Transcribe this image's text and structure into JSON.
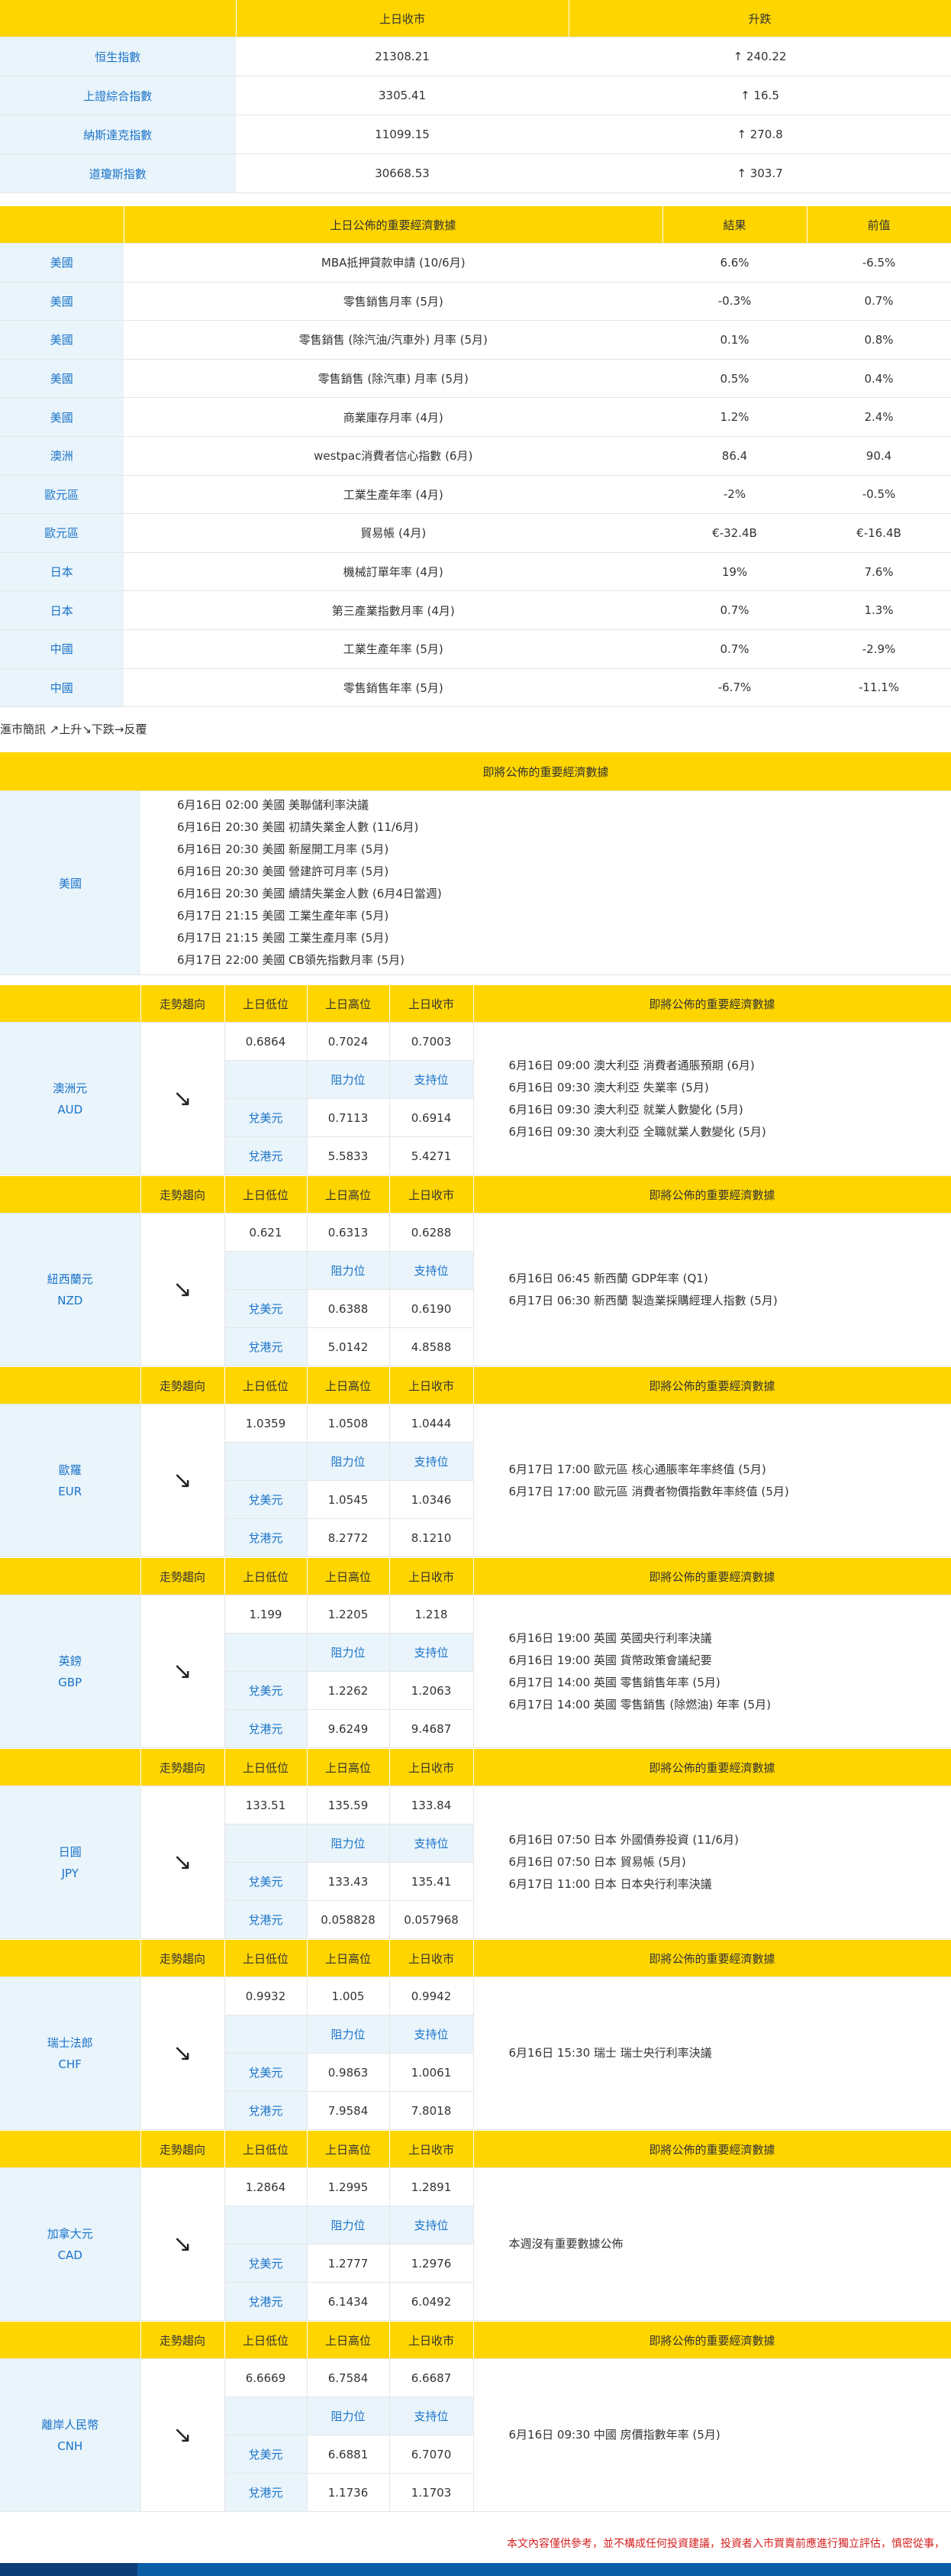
{
  "indices": {
    "headers": [
      "上日收市",
      "升跌"
    ],
    "rows": [
      {
        "name": "恒生指數",
        "close": "21308.21",
        "change": "↑  240.22"
      },
      {
        "name": "上證綜合指數",
        "close": "3305.41",
        "change": "↑  16.5"
      },
      {
        "name": "納斯達克指數",
        "close": "11099.15",
        "change": "↑  270.8"
      },
      {
        "name": "道瓊斯指數",
        "close": "30668.53",
        "change": "↑  303.7"
      }
    ]
  },
  "economic": {
    "headers": [
      "上日公佈的重要經濟數據",
      "結果",
      "前值"
    ],
    "rows": [
      {
        "region": "美國",
        "item": "MBA抵押貸款申請 (10/6月)",
        "result": "6.6%",
        "prev": "-6.5%"
      },
      {
        "region": "美國",
        "item": "零售銷售月率 (5月)",
        "result": "-0.3%",
        "prev": "0.7%"
      },
      {
        "region": "美國",
        "item": "零售銷售 (除汽油/汽車外) 月率 (5月)",
        "result": "0.1%",
        "prev": "0.8%"
      },
      {
        "region": "美國",
        "item": "零售銷售 (除汽車) 月率 (5月)",
        "result": "0.5%",
        "prev": "0.4%"
      },
      {
        "region": "美國",
        "item": "商業庫存月率 (4月)",
        "result": "1.2%",
        "prev": "2.4%"
      },
      {
        "region": "澳洲",
        "item": "westpac消費者信心指數 (6月)",
        "result": "86.4",
        "prev": "90.4"
      },
      {
        "region": "歐元區",
        "item": "工業生產年率 (4月)",
        "result": "-2%",
        "prev": "-0.5%"
      },
      {
        "region": "歐元區",
        "item": "貿易帳 (4月)",
        "result": "€-32.4B",
        "prev": "€-16.4B"
      },
      {
        "region": "日本",
        "item": "機械訂單年率 (4月)",
        "result": "19%",
        "prev": "7.6%"
      },
      {
        "region": "日本",
        "item": "第三產業指數月率 (4月)",
        "result": "0.7%",
        "prev": "1.3%"
      },
      {
        "region": "中國",
        "item": "工業生產年率 (5月)",
        "result": "0.7%",
        "prev": "-2.9%"
      },
      {
        "region": "中國",
        "item": "零售銷售年率 (5月)",
        "result": "-6.7%",
        "prev": "-11.1%"
      }
    ]
  },
  "legend": "滙市簡訊 ↗上升↘下跌→反覆",
  "upcoming_us": {
    "header": "即將公佈的重要經濟數據",
    "region": "美國",
    "events": [
      "6月16日 02:00 美國 美聯儲利率決議",
      "6月16日 20:30 美國 初請失業金人數 (11/6月)",
      "6月16日 20:30 美國 新屋開工月率 (5月)",
      "6月16日 20:30 美國 營建許可月率 (5月)",
      "6月16日 20:30 美國 續請失業金人數 (6月4日當週)",
      "6月17日 21:15 美國 工業生產年率 (5月)",
      "6月17日 21:15 美國 工業生產月率 (5月)",
      "6月17日 22:00 美國 CB領先指數月率 (5月)"
    ]
  },
  "fx_headers": {
    "trend": "走勢趨向",
    "low": "上日低位",
    "high": "上日高位",
    "close": "上日收市",
    "events": "即將公佈的重要經濟數據",
    "resistance": "阻力位",
    "support": "支持位",
    "vs_usd": "兌美元",
    "vs_hkd": "兌港元"
  },
  "currencies": [
    {
      "name": "澳洲元",
      "code": "AUD",
      "trend": "↘",
      "low": "0.6864",
      "high": "0.7024",
      "close": "0.7003",
      "usd_res": "0.7113",
      "usd_sup": "0.6914",
      "hkd_res": "5.5833",
      "hkd_sup": "5.4271",
      "events": [
        "6月16日 09:00 澳大利亞 消費者通脹預期 (6月)",
        "6月16日 09:30 澳大利亞 失業率 (5月)",
        "6月16日 09:30 澳大利亞 就業人數變化 (5月)",
        "6月16日 09:30 澳大利亞 全職就業人數變化 (5月)"
      ]
    },
    {
      "name": "紐西蘭元",
      "code": "NZD",
      "trend": "↘",
      "low": "0.621",
      "high": "0.6313",
      "close": "0.6288",
      "usd_res": "0.6388",
      "usd_sup": "0.6190",
      "hkd_res": "5.0142",
      "hkd_sup": "4.8588",
      "events": [
        "6月16日 06:45 新西蘭 GDP年率 (Q1)",
        "6月17日 06:30 新西蘭 製造業採購經理人指數 (5月)"
      ]
    },
    {
      "name": "歐羅",
      "code": "EUR",
      "trend": "↘",
      "low": "1.0359",
      "high": "1.0508",
      "close": "1.0444",
      "usd_res": "1.0545",
      "usd_sup": "1.0346",
      "hkd_res": "8.2772",
      "hkd_sup": "8.1210",
      "events": [
        "6月17日 17:00 歐元區 核心通脹率年率終值 (5月)",
        "6月17日 17:00 歐元區 消費者物價指數年率終值 (5月)"
      ]
    },
    {
      "name": "英鎊",
      "code": "GBP",
      "trend": "↘",
      "low": "1.199",
      "high": "1.2205",
      "close": "1.218",
      "usd_res": "1.2262",
      "usd_sup": "1.2063",
      "hkd_res": "9.6249",
      "hkd_sup": "9.4687",
      "events": [
        "6月16日 19:00 英國 英國央行利率決議",
        "6月16日 19:00 英國 貨幣政策會議紀要",
        "6月17日 14:00 英國 零售銷售年率 (5月)",
        "6月17日 14:00 英國 零售銷售 (除燃油) 年率 (5月)"
      ]
    },
    {
      "name": "日圓",
      "code": "JPY",
      "trend": "↘",
      "low": "133.51",
      "high": "135.59",
      "close": "133.84",
      "usd_res": "133.43",
      "usd_sup": "135.41",
      "hkd_res": "0.058828",
      "hkd_sup": "0.057968",
      "events": [
        "6月16日 07:50 日本 外國債券投資 (11/6月)",
        "6月16日 07:50 日本 貿易帳 (5月)",
        "6月17日 11:00 日本 日本央行利率決議"
      ]
    },
    {
      "name": "瑞士法郎",
      "code": "CHF",
      "trend": "↘",
      "low": "0.9932",
      "high": "1.005",
      "close": "0.9942",
      "usd_res": "0.9863",
      "usd_sup": "1.0061",
      "hkd_res": "7.9584",
      "hkd_sup": "7.8018",
      "events": [
        "6月16日 15:30 瑞士 瑞士央行利率決議"
      ]
    },
    {
      "name": "加拿大元",
      "code": "CAD",
      "trend": "↘",
      "low": "1.2864",
      "high": "1.2995",
      "close": "1.2891",
      "usd_res": "1.2777",
      "usd_sup": "1.2976",
      "hkd_res": "6.1434",
      "hkd_sup": "6.0492",
      "events": [
        "本週沒有重要數據公佈"
      ]
    },
    {
      "name": "離岸人民幣",
      "code": "CNH",
      "trend": "↘",
      "low": "6.6669",
      "high": "6.7584",
      "close": "6.6687",
      "usd_res": "6.6881",
      "usd_sup": "6.7070",
      "hkd_res": "1.1736",
      "hkd_sup": "1.1703",
      "events": [
        "6月16日 09:30 中國 房價指數年率 (5月)"
      ]
    }
  ],
  "disclaimer": "本文內容僅供參考，並不構成任何投資建議，投資者入市買賣前應進行獨立評估，慎密從事，",
  "colors": {
    "header": "#ffd500",
    "label_bg": "#e9f4fb",
    "link": "#1a73c8",
    "disclaimer": "#d42020",
    "footer": "#0a5ea6"
  }
}
